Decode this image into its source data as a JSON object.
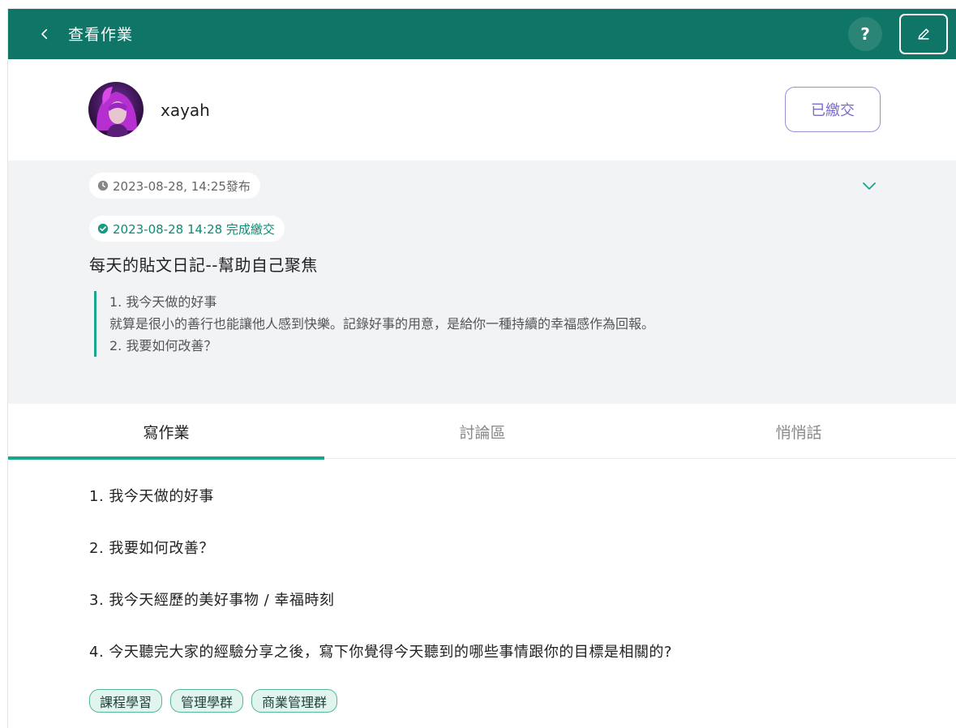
{
  "header": {
    "title": "查看作業",
    "help_label": "?",
    "accent": "#0f7566"
  },
  "user": {
    "name": "xayah",
    "status_button": "已繳交"
  },
  "info": {
    "published": "2023-08-28, 14:25發布",
    "submitted": "2023-08-28 14:28 完成繳交",
    "task_title": "每天的貼文日記--幫助自己聚焦",
    "description": [
      "1. 我今天做的好事",
      "就算是很小的善行也能讓他人感到快樂。記錄好事的用意，是給你一種持續的幸福感作為回報。",
      "2. 我要如何改善？"
    ]
  },
  "tabs": [
    {
      "label": "寫作業",
      "active": true
    },
    {
      "label": "討論區",
      "active": false
    },
    {
      "label": "悄悄話",
      "active": false
    }
  ],
  "questions": [
    "1. 我今天做的好事",
    "2. 我要如何改善？",
    "3. 我今天經歷的美好事物 / 幸福時刻",
    "4. 今天聽完大家的經驗分享之後，寫下你覺得今天聽到的哪些事情跟你的目標是相關的?"
  ],
  "tags": [
    "課程學習",
    "管理學群",
    "商業管理群"
  ],
  "icons": {
    "back": "chevron-left-icon",
    "edit": "pencil-icon",
    "collapse": "chevron-down-icon",
    "published": "clock-icon",
    "submitted": "check-circle-icon"
  }
}
